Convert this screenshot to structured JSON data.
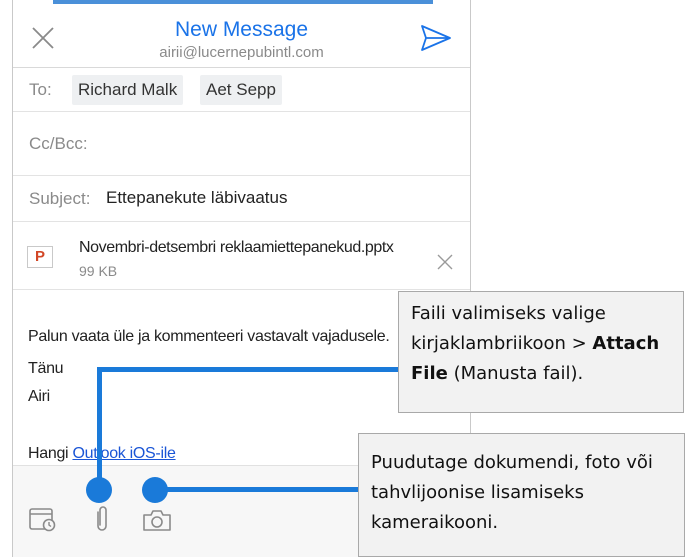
{
  "header": {
    "title": "New Message",
    "sender": "airii@lucernepubintl.com"
  },
  "recipients": {
    "to_label": "To:",
    "to": [
      "Richard Malk",
      "Aet Sepp"
    ],
    "cc_label": "Cc/Bcc:"
  },
  "subject": {
    "label": "Subject:",
    "value": "Ettepanekute läbivaatus"
  },
  "attachment": {
    "icon_letter": "P",
    "name": "Novembri-detsembri reklaamiettepanekud.pptx",
    "size": "99 KB"
  },
  "body": {
    "line1": "Palun vaata üle ja kommenteeri vastavalt vajadusele.",
    "line2": "Tänu",
    "line3": "Airi",
    "signature_prefix": "Hangi ",
    "signature_link": "Outlook iOS-ile"
  },
  "callouts": {
    "attach_part1": "Faili valimiseks valige kirjaklambriikoon > ",
    "attach_bold": "Attach File",
    "attach_part2": " (Manusta fail).",
    "camera": "Puudutage dokumendi, foto või tahvlijoonise lisamiseks kameraikooni."
  },
  "colors": {
    "accent": "#1a73e8",
    "callout_line": "#1a7ad9",
    "ppt": "#d24726"
  },
  "icons": {
    "close": "close-icon",
    "send": "send-icon",
    "calendar": "calendar-icon",
    "attach": "paperclip-icon",
    "camera": "camera-icon"
  }
}
